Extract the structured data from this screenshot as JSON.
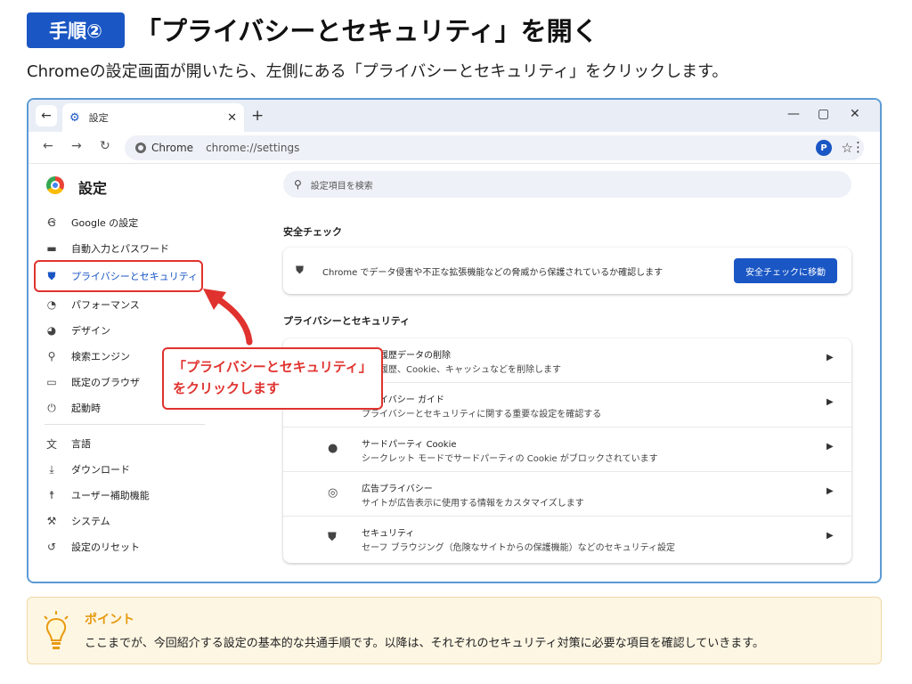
{
  "header": {
    "step_badge": "手順②",
    "title": "「プライバシーとセキュリティ」を開く",
    "description": "Chromeの設定画面が開いたら、左側にある「プライバシーとセキュリティ」をクリックします。"
  },
  "browser": {
    "tab_title": "設定",
    "tab_close": "✕",
    "new_tab": "+",
    "window_controls": {
      "minimize": "—",
      "maximize": "▢",
      "close": "✕"
    },
    "nav": {
      "back": "←",
      "forward": "→",
      "reload": "↻"
    },
    "omnibox": {
      "site_label": "Chrome",
      "url": "chrome://settings"
    },
    "bookmark_star": "☆",
    "avatar_letter": "P",
    "menu": "⋮"
  },
  "sidebar": {
    "title": "設定",
    "items": [
      {
        "label": "Google の設定",
        "icon": "google-g-icon"
      },
      {
        "label": "自動入力とパスワード",
        "icon": "autofill-icon"
      },
      {
        "label": "プライバシーとセキュリティ",
        "icon": "shield-icon",
        "active": true
      },
      {
        "label": "パフォーマンス",
        "icon": "speedometer-icon"
      },
      {
        "label": "デザイン",
        "icon": "palette-icon"
      },
      {
        "label": "検索エンジン",
        "icon": "search-icon"
      },
      {
        "label": "既定のブラウザ",
        "icon": "browser-icon"
      },
      {
        "label": "起動時",
        "icon": "power-icon"
      },
      {
        "label": "言語",
        "icon": "language-icon"
      },
      {
        "label": "ダウンロード",
        "icon": "download-icon"
      },
      {
        "label": "ユーザー補助機能",
        "icon": "accessibility-icon"
      },
      {
        "label": "システム",
        "icon": "wrench-icon"
      },
      {
        "label": "設定のリセット",
        "icon": "reset-icon"
      }
    ]
  },
  "main": {
    "search_placeholder": "設定項目を検索",
    "safety_check": {
      "heading": "安全チェック",
      "text": "Chrome でデータ侵害や不正な拡張機能などの脅威から保護されているか確認します",
      "button": "安全チェックに移動"
    },
    "privacy": {
      "heading": "プライバシーとセキュリティ",
      "rows": [
        {
          "title": "閲覧履歴データの削除",
          "subtitle": "閲覧履歴、Cookie、キャッシュなどを削除します",
          "icon": "trash-icon"
        },
        {
          "title": "プライバシー ガイド",
          "subtitle": "プライバシーとセキュリティに関する重要な設定を確認する",
          "icon": "privacy-guide-icon"
        },
        {
          "title": "サードパーティ Cookie",
          "subtitle": "シークレット モードでサードパーティの Cookie がブロックされています",
          "icon": "cookie-icon"
        },
        {
          "title": "広告プライバシー",
          "subtitle": "サイトが広告表示に使用する情報をカスタマイズします",
          "icon": "ad-privacy-icon"
        },
        {
          "title": "セキュリティ",
          "subtitle": "セーフ ブラウジング（危険なサイトからの保護機能）などのセキュリティ設定",
          "icon": "shield-icon"
        }
      ]
    }
  },
  "callout": {
    "line1": "「プライバシーとセキュリティ」",
    "line2": "をクリックします"
  },
  "point": {
    "title": "ポイント",
    "text": "ここまでが、今回紹介する設定の基本的な共通手順です。以降は、それぞれのセキュリティ対策に必要な項目を確認していきます。"
  },
  "colors": {
    "accent": "#1a56c4",
    "highlight_red": "#e0322e",
    "point_orange": "#e89a10"
  }
}
